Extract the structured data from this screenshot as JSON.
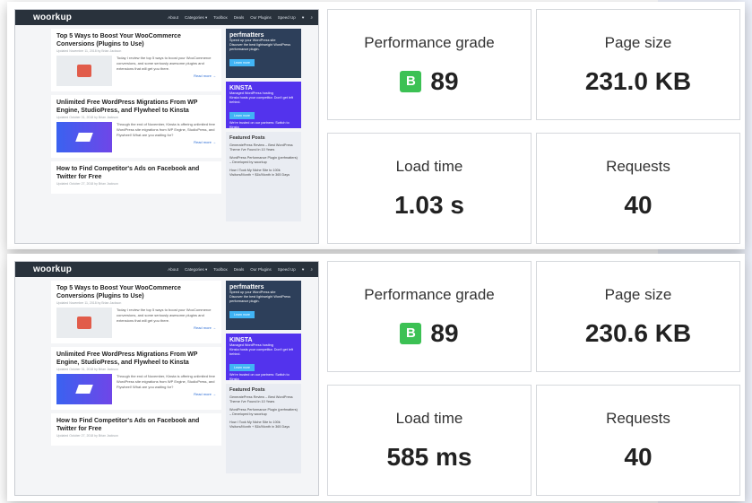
{
  "colors": {
    "grade_badge": "#3cc154",
    "nav_bg": "#29323c",
    "kinsta_bg": "#5333ed",
    "perfmatters_bg": "#2d3f5a"
  },
  "panels": [
    {
      "website": {
        "logo": "woorkup",
        "nav": [
          "About",
          "Categories ▾",
          "Toolbox",
          "Deals",
          "Our Plugins",
          "Speed Up",
          "♥",
          "⌕"
        ],
        "posts": [
          {
            "title": "Top 5 Ways to Boost Your WooCommerce Conversions (Plugins to Use)",
            "meta": "Updated November 11, 2018 by Brian Jackson",
            "excerpt": "Today I review the top 5 ways to boost your WooCommerce conversions, and some seriously awesome plugins and extensions that will get you there.",
            "read_more": "Read more →"
          },
          {
            "title": "Unlimited Free WordPress Migrations From WP Engine, StudioPress, and Flywheel to Kinsta",
            "meta": "Updated October 31, 2018 by Brian Jackson",
            "excerpt": "Through the end of November, Kinsta is offering unlimited free WordPress site migrations from WP Engine, StudioPress, and Flywheel! What are you waiting for?",
            "read_more": "Read more →"
          },
          {
            "title": "How to Find Competitor's Ads on Facebook and Twitter for Free",
            "meta": "Updated October 27, 2018 by Brian Jackson"
          }
        ],
        "sidebar": {
          "perfmatters": {
            "brand": "perfmatters",
            "headline": "Speed up your WordPress site",
            "text": "Discover the best lightweight WordPress performance plugin.",
            "button": "Learn more"
          },
          "kinsta": {
            "brand": "KINSTA",
            "headline": "Managed WordPress hosting",
            "text": "Kinsta hosts your competitor. Don't get left behind.",
            "button": "Learn more",
            "footer": "We're trusted on our partners: Switch to Kinsta"
          },
          "featured": {
            "heading": "Featured Posts",
            "items": [
              "GeneratePress Review – Best WordPress Theme I've Found in 10 Years",
              "WordPress Performance Plugin (perfmatters) – Developed by woorkup",
              "How I Took My Niche Site to 100k Visitors/Month + $1k/Month in 365 Days"
            ]
          }
        }
      },
      "metrics": {
        "performance_grade": {
          "label": "Performance grade",
          "grade": "B",
          "score": "89"
        },
        "page_size": {
          "label": "Page size",
          "value": "231.0 KB"
        },
        "load_time": {
          "label": "Load time",
          "value": "1.03 s"
        },
        "requests": {
          "label": "Requests",
          "value": "40"
        }
      }
    },
    {
      "website": {
        "logo": "woorkup",
        "nav": [
          "About",
          "Categories ▾",
          "Toolbox",
          "Deals",
          "Our Plugins",
          "Speed Up",
          "♥",
          "⌕"
        ],
        "posts": [
          {
            "title": "Top 5 Ways to Boost Your WooCommerce Conversions (Plugins to Use)",
            "meta": "Updated November 11, 2018 by Brian Jackson",
            "excerpt": "Today I review the top 5 ways to boost your WooCommerce conversions, and some seriously awesome plugins and extensions that will get you there.",
            "read_more": "Read more →"
          },
          {
            "title": "Unlimited Free WordPress Migrations From WP Engine, StudioPress, and Flywheel to Kinsta",
            "meta": "Updated October 31, 2018 by Brian Jackson",
            "excerpt": "Through the end of November, Kinsta is offering unlimited free WordPress site migrations from WP Engine, StudioPress, and Flywheel! What are you waiting for?",
            "read_more": "Read more →"
          },
          {
            "title": "How to Find Competitor's Ads on Facebook and Twitter for Free",
            "meta": "Updated October 27, 2018 by Brian Jackson"
          }
        ],
        "sidebar": {
          "perfmatters": {
            "brand": "perfmatters",
            "headline": "Speed up your WordPress site",
            "text": "Discover the best lightweight WordPress performance plugin.",
            "button": "Learn more"
          },
          "kinsta": {
            "brand": "KINSTA",
            "headline": "Managed WordPress hosting",
            "text": "Kinsta hosts your competitor. Don't get left behind.",
            "button": "Learn more",
            "footer": "We're trusted on our partners: Switch to Kinsta"
          },
          "featured": {
            "heading": "Featured Posts",
            "items": [
              "GeneratePress Review – Best WordPress Theme I've Found in 10 Years",
              "WordPress Performance Plugin (perfmatters) – Developed by woorkup",
              "How I Took My Niche Site to 100k Visitors/Month + $1k/Month in 365 Days"
            ]
          }
        }
      },
      "metrics": {
        "performance_grade": {
          "label": "Performance grade",
          "grade": "B",
          "score": "89"
        },
        "page_size": {
          "label": "Page size",
          "value": "230.6 KB"
        },
        "load_time": {
          "label": "Load time",
          "value": "585 ms"
        },
        "requests": {
          "label": "Requests",
          "value": "40"
        }
      }
    }
  ]
}
